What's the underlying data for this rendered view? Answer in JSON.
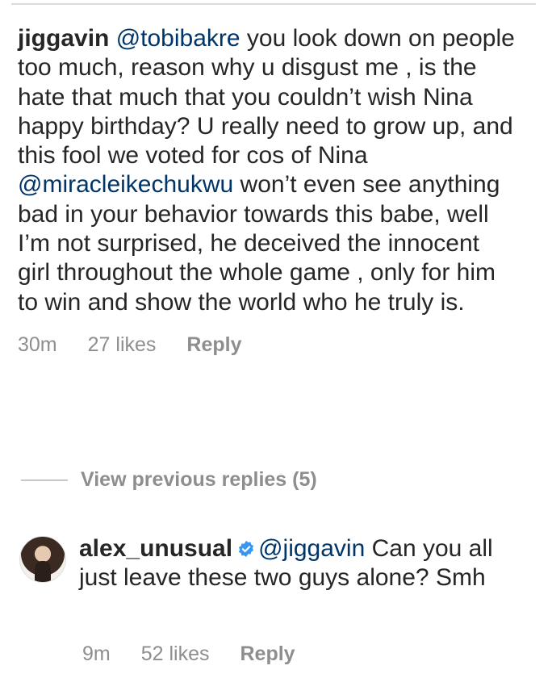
{
  "comment": {
    "username": "jiggavin",
    "mention_1": "@tobibakre",
    "text_1": " you look down on people too much, reason why u disgust me , is the hate that much that you couldn’t wish Nina happy birthday? U really need to grow up, and this fool we voted for cos of Nina ",
    "mention_2": "@miracleikechukwu",
    "text_2": " won’t even see anything bad in your behavior towards this babe, well I’m not surprised, he deceived the innocent girl throughout the whole game , only for him to win and show the world who he truly is.",
    "time": "30m",
    "likes": "27 likes",
    "reply_label": "Reply"
  },
  "view_previous": {
    "label": "View previous replies (5)"
  },
  "reply": {
    "username": "alex_unusual",
    "verified_icon": "verified-badge-icon",
    "mention": "@jiggavin",
    "text": " Can you all just leave these two guys alone? Smh",
    "time": "9m",
    "likes": "52 likes",
    "reply_label": "Reply"
  },
  "colors": {
    "text": "#262626",
    "mention": "#003569",
    "meta": "#8e8e8e",
    "verified": "#3897f0"
  }
}
